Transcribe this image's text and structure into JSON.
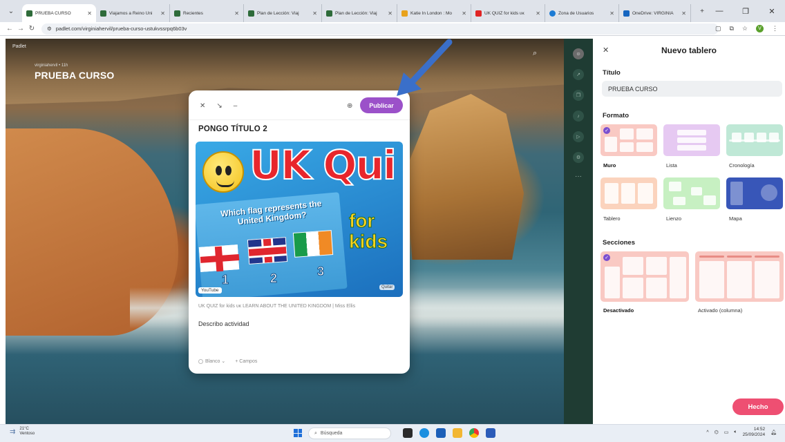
{
  "browser": {
    "tabs": [
      {
        "label": "PRUEBA CURSO",
        "color": "#2e6b3a",
        "active": true
      },
      {
        "label": "Viajamos a Reino Uni",
        "color": "#2e6b3a"
      },
      {
        "label": "Recientes",
        "color": "#2e6b3a"
      },
      {
        "label": "Plan de Lección: Viaj",
        "color": "#2e6b3a"
      },
      {
        "label": "Plan de Lección: Viaj",
        "color": "#2e6b3a"
      },
      {
        "label": "Katie In London : Mo",
        "color": "#e8a21c"
      },
      {
        "label": "UK QUIZ for kids ᴜᴋ",
        "color": "#e02424"
      },
      {
        "label": "Zona de Usuarios",
        "color": "#1c7bd4"
      },
      {
        "label": "OneDrive: VIRGINIA",
        "color": "#1565c0"
      }
    ],
    "url": "padlet.com/virginiahervil/prueba-curso-ustukvssrpq6b03v",
    "avatar_letter": "V"
  },
  "board": {
    "brand": "Padlet",
    "user_line": "virginiahervil • 11h",
    "title": "PRUEBA CURSO"
  },
  "post_editor": {
    "publish_label": "Publicar",
    "title": "PONGO TÍTULO 2",
    "attachment": {
      "heading_text": "UK Qui",
      "question_line1": "Which flag represents the",
      "question_line2": "United Kingdom?",
      "for_text": "for",
      "kids_text": "kids",
      "numbers": [
        "1",
        "2",
        "3"
      ],
      "source_badge": "YouTube",
      "remove_label": "Quitar",
      "caption": "UK QUIZ for kids ᴜᴋ LEARN ABOUT THE UNITED KINGDOM | Miss Ellis"
    },
    "description": "Describo actividad",
    "color_label": "Blanco",
    "fields_label": "Campos"
  },
  "panel": {
    "header": "Nuevo tablero",
    "title_label": "Título",
    "title_value": "PRUEBA CURSO",
    "format_label": "Formato",
    "formats": [
      {
        "label": "Muro",
        "color": "#f9c9c3",
        "selected": true
      },
      {
        "label": "Lista",
        "color": "#e6c9f2"
      },
      {
        "label": "Cronología",
        "color": "#bfe8d6"
      },
      {
        "label": "Tablero",
        "color": "#fbd3bd"
      },
      {
        "label": "Lienzo",
        "color": "#c7f0c2"
      },
      {
        "label": "Mapa",
        "color": "#3856b8"
      }
    ],
    "sections_label": "Secciones",
    "sections": [
      {
        "label": "Desactivado",
        "selected": true
      },
      {
        "label": "Activado (columna)"
      }
    ],
    "done_label": "Hecho"
  },
  "taskbar": {
    "temp": "21°C",
    "weather": "Ventoso",
    "search_placeholder": "Búsqueda",
    "time": "14:52",
    "date": "25/09/2024"
  },
  "colors": {
    "publish": "#9b51c9",
    "done": "#ee4f72",
    "rail": "#1f3c33",
    "arrow": "#3a6fc9"
  }
}
